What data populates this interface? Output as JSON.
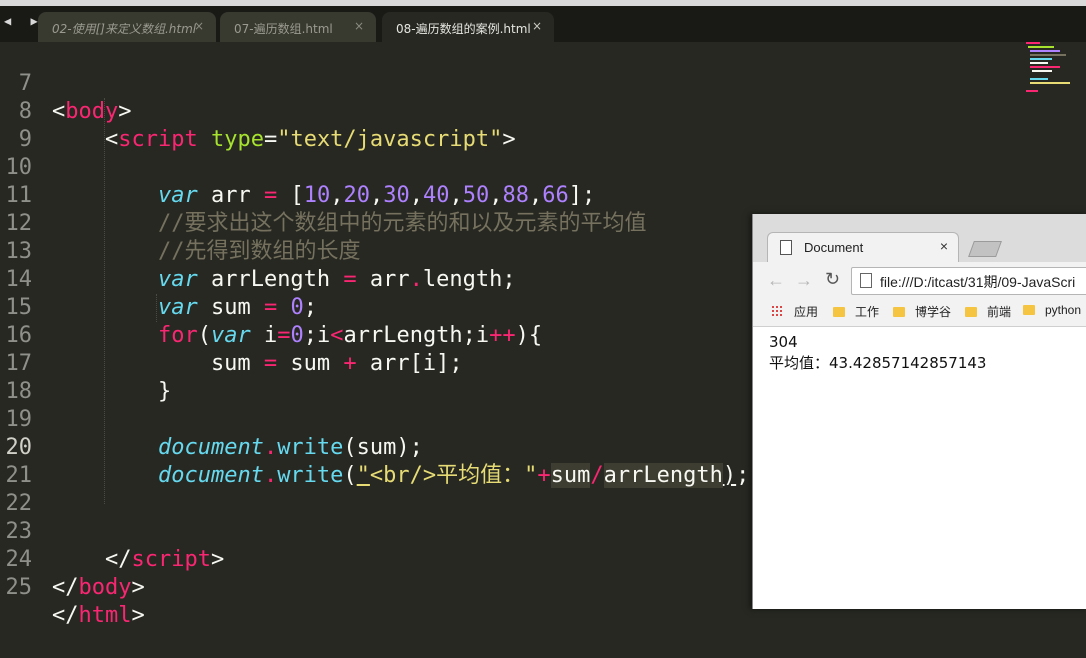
{
  "editor": {
    "tabs": [
      {
        "label": "02-使用[]来定义数组.html",
        "close": "×"
      },
      {
        "label": "07-遍历数组.html",
        "close": "×"
      },
      {
        "label": "08-遍历数组的案例.html",
        "close": "×"
      }
    ],
    "nav_arrows": "◀ ▶",
    "line_numbers": [
      "7",
      "8",
      "9",
      "10",
      "11",
      "12",
      "13",
      "14",
      "15",
      "16",
      "17",
      "18",
      "19",
      "20",
      "21",
      "22",
      "23",
      "24",
      "25"
    ]
  },
  "browser": {
    "tab_title": "Document",
    "tab_close": "×",
    "url": "file:///D:/itcast/31期/09-JavaScri",
    "bookmarks": [
      "应用",
      "工作",
      "博学谷",
      "前端",
      "python"
    ],
    "output_line1": "304",
    "output_line2": "平均值：43.42857142857143"
  },
  "colors": {
    "editor_bg": "#272822",
    "tag": "#f92672",
    "keyword": "#66d9ef",
    "number": "#ae81ff",
    "string": "#e6db74",
    "comment": "#75715e"
  }
}
